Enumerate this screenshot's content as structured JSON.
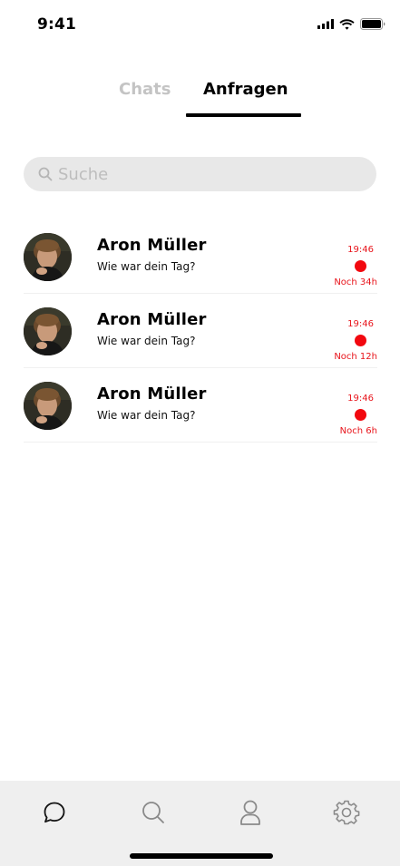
{
  "status_bar": {
    "time": "9:41",
    "icons": [
      "signal-icon",
      "wifi-icon",
      "battery-icon"
    ]
  },
  "tabs": [
    {
      "label": "Chats",
      "active": false
    },
    {
      "label": "Anfragen",
      "active": true
    }
  ],
  "search": {
    "placeholder": "Suche",
    "icon": "search-icon"
  },
  "chats": [
    {
      "name": "Aron Müller",
      "preview": "Wie war dein Tag?",
      "time": "19:46",
      "unread": true,
      "expiry": "Noch 34h"
    },
    {
      "name": "Aron Müller",
      "preview": "Wie war dein Tag?",
      "time": "19:46",
      "unread": true,
      "expiry": "Noch 12h"
    },
    {
      "name": "Aron Müller",
      "preview": "Wie war dein Tag?",
      "time": "19:46",
      "unread": true,
      "expiry": "Noch 6h"
    }
  ],
  "bottom_nav": {
    "items": [
      "chat-bubble-icon",
      "search-icon",
      "user-icon",
      "gear-icon"
    ]
  },
  "colors": {
    "accent_red": "#f2080f",
    "inactive_tab": "#c4c4c4",
    "search_bg": "#e8e8e8",
    "nav_bg": "#efefef"
  }
}
